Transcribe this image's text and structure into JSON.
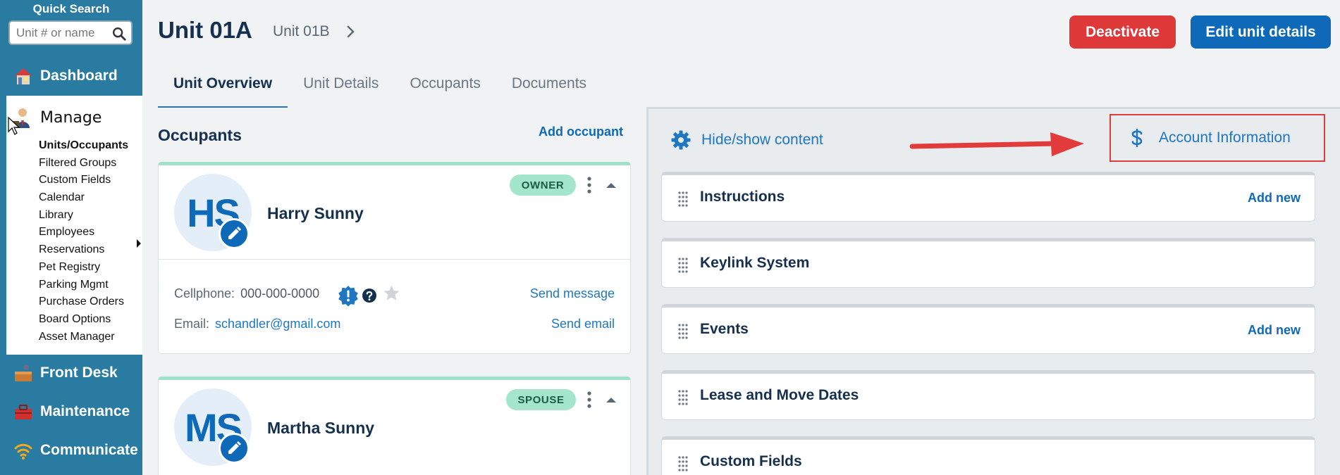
{
  "sidebar": {
    "quick_search_title": "Quick Search",
    "search_placeholder": "Unit # or name",
    "nav": [
      {
        "label": "Dashboard"
      },
      {
        "label": "Front Desk"
      },
      {
        "label": "Maintenance"
      },
      {
        "label": "Communicate"
      }
    ],
    "manage": {
      "label": "Manage",
      "items": [
        {
          "label": "Units/Occupants"
        },
        {
          "label": "Filtered Groups"
        },
        {
          "label": "Custom Fields"
        },
        {
          "label": "Calendar"
        },
        {
          "label": "Library"
        },
        {
          "label": "Employees"
        },
        {
          "label": "Reservations"
        },
        {
          "label": "Pet Registry"
        },
        {
          "label": "Parking Mgmt"
        },
        {
          "label": "Purchase Orders"
        },
        {
          "label": "Board Options"
        },
        {
          "label": "Asset Manager"
        }
      ]
    }
  },
  "header": {
    "unit_title": "Unit 01A",
    "next_unit": "Unit 01B",
    "deactivate_label": "Deactivate",
    "edit_label": "Edit unit details"
  },
  "tabs": [
    {
      "label": "Unit Overview"
    },
    {
      "label": "Unit Details"
    },
    {
      "label": "Occupants"
    },
    {
      "label": "Documents"
    }
  ],
  "occupants": {
    "title": "Occupants",
    "add_label": "Add occupant",
    "cards": [
      {
        "initials": "HS",
        "name": "Harry Sunny",
        "role": "OWNER",
        "cell_label": "Cellphone:",
        "cell_value": "000-000-0000",
        "email_label": "Email:",
        "email_value": "schandler@gmail.com",
        "send_message": "Send message",
        "send_email": "Send email"
      },
      {
        "initials": "MS",
        "name": "Martha Sunny",
        "role": "SPOUSE"
      }
    ]
  },
  "panel": {
    "hide_show_label": "Hide/show content",
    "account_info_label": "Account Information",
    "cards": [
      {
        "title": "Instructions",
        "action": "Add new"
      },
      {
        "title": "Keylink System",
        "action": ""
      },
      {
        "title": "Events",
        "action": "Add new"
      },
      {
        "title": "Lease and Move Dates",
        "action": ""
      },
      {
        "title": "Custom Fields",
        "action": ""
      }
    ]
  },
  "colors": {
    "sidebar": "#2a7ba2",
    "primary": "#0e6ab8",
    "danger": "#de3838",
    "badge": "#a3e6cb",
    "highlight": "#e23b3b"
  }
}
